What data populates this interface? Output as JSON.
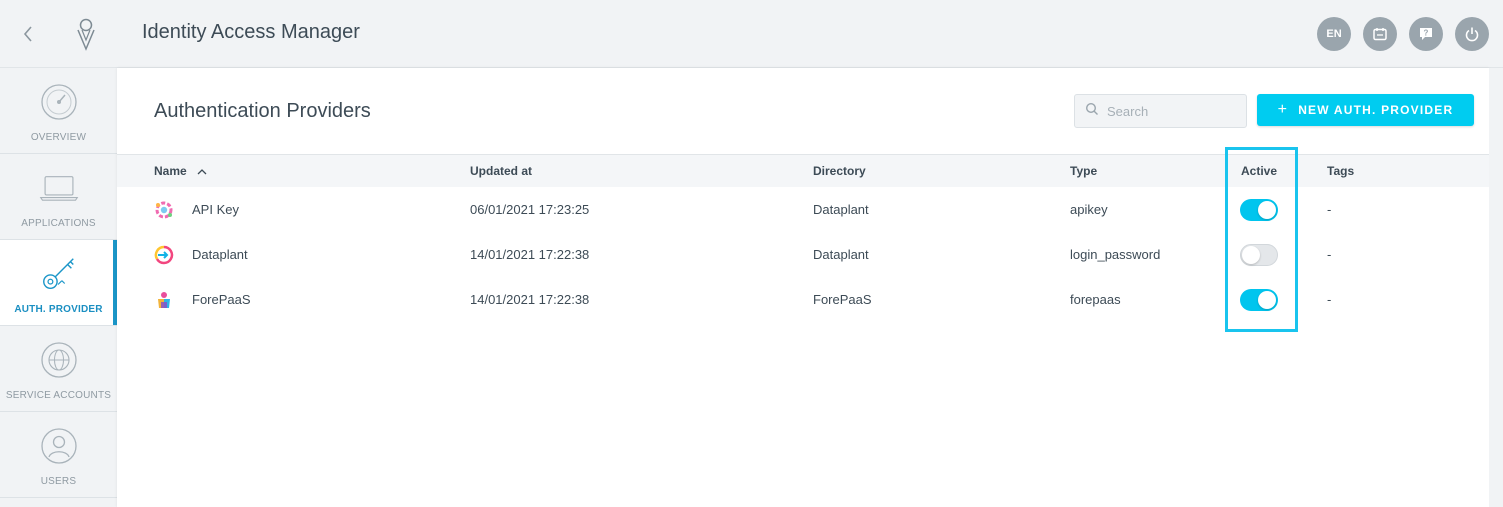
{
  "header": {
    "title": "Identity Access Manager",
    "lang_label": "EN",
    "icons": [
      "back-chevron-icon",
      "logo-icon",
      "language-icon",
      "calendar-icon",
      "help-icon",
      "power-icon"
    ]
  },
  "sidebar": {
    "items": [
      {
        "label": "OVERVIEW",
        "icon": "gauge-icon",
        "active": false
      },
      {
        "label": "APPLICATIONS",
        "icon": "laptop-icon",
        "active": false
      },
      {
        "label": "AUTH. PROVIDER",
        "icon": "keys-icon",
        "active": true
      },
      {
        "label": "SERVICE ACCOUNTS",
        "icon": "globe-gear-icon",
        "active": false
      },
      {
        "label": "USERS",
        "icon": "user-icon",
        "active": false
      }
    ]
  },
  "main": {
    "title": "Authentication Providers",
    "search": {
      "placeholder": "Search",
      "value": ""
    },
    "new_button_label": "NEW AUTH. PROVIDER",
    "columns": {
      "name": "Name",
      "updated": "Updated at",
      "directory": "Directory",
      "type": "Type",
      "active": "Active",
      "tags": "Tags"
    },
    "rows": [
      {
        "name": "API Key",
        "updated": "06/01/2021 17:23:25",
        "directory": "Dataplant",
        "type": "apikey",
        "active": true,
        "tags": "-"
      },
      {
        "name": "Dataplant",
        "updated": "14/01/2021 17:22:38",
        "directory": "Dataplant",
        "type": "login_password",
        "active": false,
        "tags": "-"
      },
      {
        "name": "ForePaaS",
        "updated": "14/01/2021 17:22:38",
        "directory": "ForePaaS",
        "type": "forepaas",
        "active": true,
        "tags": "-"
      }
    ]
  },
  "colors": {
    "accent": "#00ccf0",
    "active_nav": "#1b96c8",
    "highlight": "#19c4ee",
    "text": "#3d4b56"
  }
}
